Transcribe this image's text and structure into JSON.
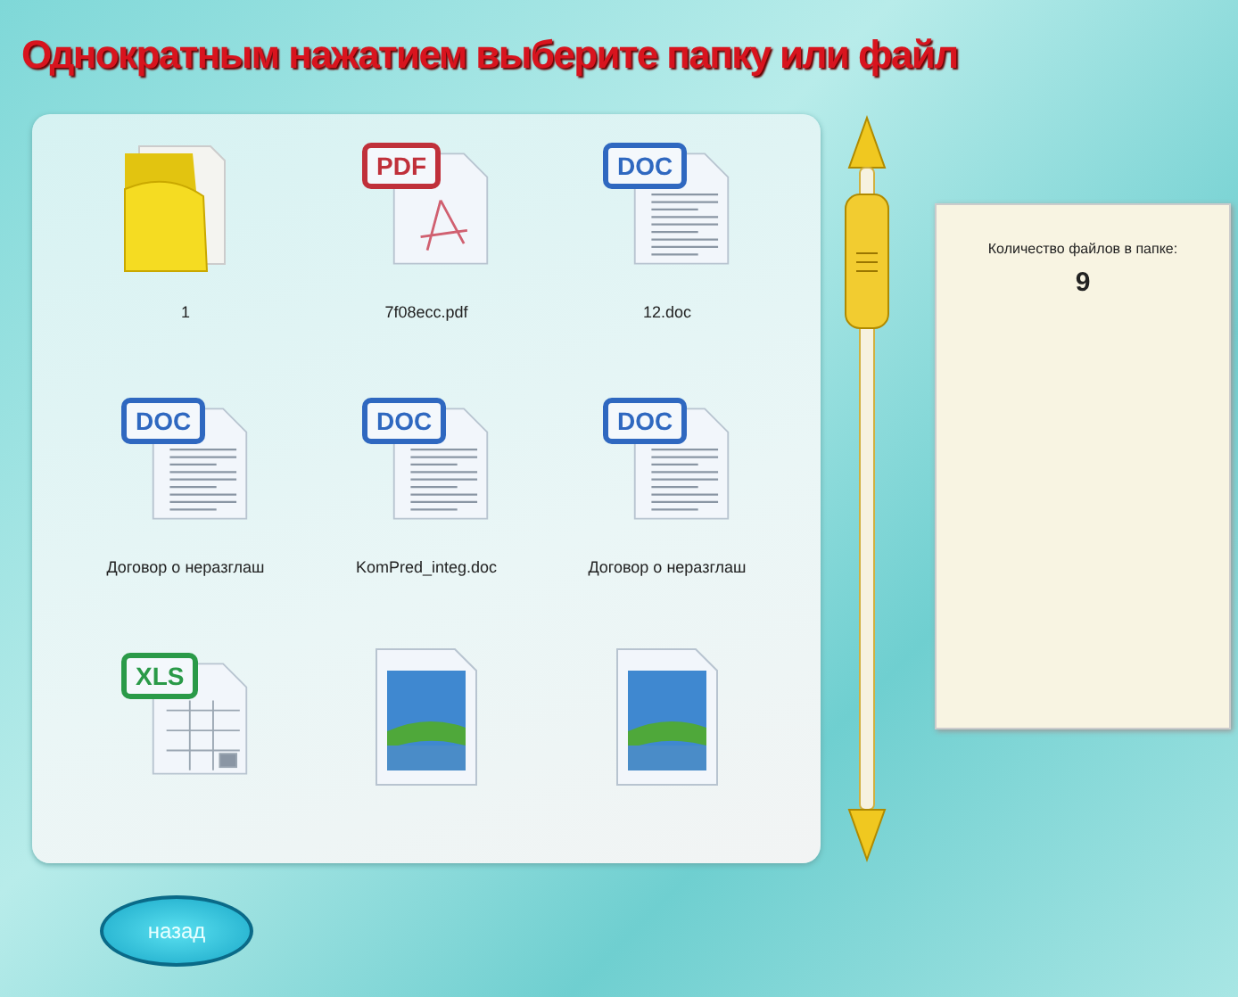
{
  "title": "Однократным нажатием выберите папку или файл",
  "files": [
    {
      "kind": "folder",
      "name": "1"
    },
    {
      "kind": "pdf",
      "badge": "PDF",
      "name": "7f08ecc.pdf"
    },
    {
      "kind": "doc",
      "badge": "DOC",
      "name": "12.doc"
    },
    {
      "kind": "doc",
      "badge": "DOC",
      "name": "Договор о неразглаш"
    },
    {
      "kind": "doc",
      "badge": "DOC",
      "name": "KomPred_integ.doc"
    },
    {
      "kind": "doc",
      "badge": "DOC",
      "name": "Договор о неразглаш"
    },
    {
      "kind": "xls",
      "badge": "XLS"
    },
    {
      "kind": "image"
    },
    {
      "kind": "image"
    }
  ],
  "info": {
    "label": "Количество файлов в папке:",
    "count": "9"
  },
  "back_button": "назад"
}
